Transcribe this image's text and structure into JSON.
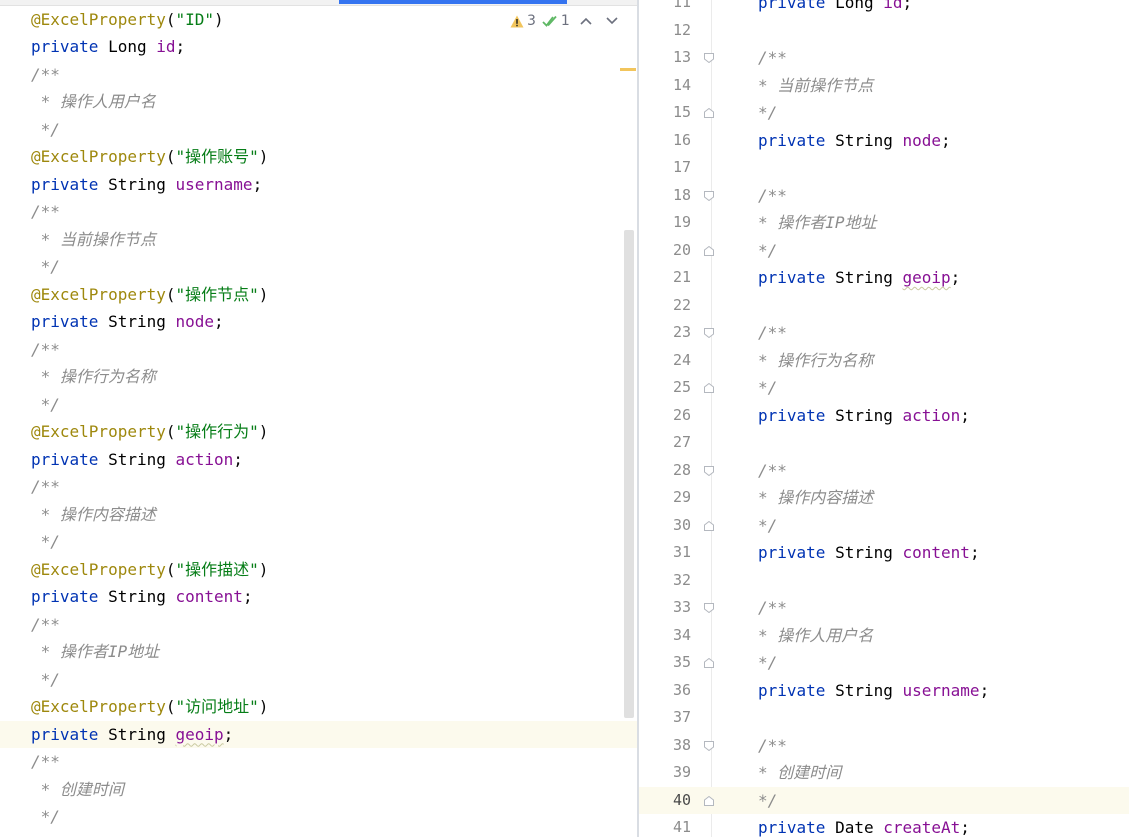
{
  "inspection": {
    "warnings": "3",
    "weak_warnings": "1"
  },
  "left_editor": {
    "lines": [
      {
        "tokens": [
          {
            "t": "anno",
            "v": "@ExcelProperty"
          },
          {
            "t": "plain",
            "v": "("
          },
          {
            "t": "str",
            "v": "\"ID\""
          },
          {
            "t": "plain",
            "v": ")"
          }
        ]
      },
      {
        "tokens": [
          {
            "t": "kw",
            "v": "private "
          },
          {
            "t": "typ",
            "v": "Long "
          },
          {
            "t": "fld",
            "v": "id"
          },
          {
            "t": "plain",
            "v": ";"
          }
        ]
      },
      {
        "tokens": [
          {
            "t": "cmt",
            "v": "/**"
          }
        ]
      },
      {
        "tokens": [
          {
            "t": "cmt",
            "v": " * 操作人用户名"
          }
        ]
      },
      {
        "tokens": [
          {
            "t": "cmt",
            "v": " */"
          }
        ]
      },
      {
        "tokens": [
          {
            "t": "anno",
            "v": "@ExcelProperty"
          },
          {
            "t": "plain",
            "v": "("
          },
          {
            "t": "str",
            "v": "\"操作账号\""
          },
          {
            "t": "plain",
            "v": ")"
          }
        ]
      },
      {
        "tokens": [
          {
            "t": "kw",
            "v": "private "
          },
          {
            "t": "typ",
            "v": "String "
          },
          {
            "t": "fld",
            "v": "username"
          },
          {
            "t": "plain",
            "v": ";"
          }
        ]
      },
      {
        "tokens": [
          {
            "t": "cmt",
            "v": "/**"
          }
        ]
      },
      {
        "tokens": [
          {
            "t": "cmt",
            "v": " * 当前操作节点"
          }
        ]
      },
      {
        "tokens": [
          {
            "t": "cmt",
            "v": " */"
          }
        ]
      },
      {
        "tokens": [
          {
            "t": "anno",
            "v": "@ExcelProperty"
          },
          {
            "t": "plain",
            "v": "("
          },
          {
            "t": "str",
            "v": "\"操作节点\""
          },
          {
            "t": "plain",
            "v": ")"
          }
        ]
      },
      {
        "tokens": [
          {
            "t": "kw",
            "v": "private "
          },
          {
            "t": "typ",
            "v": "String "
          },
          {
            "t": "fld",
            "v": "node"
          },
          {
            "t": "plain",
            "v": ";"
          }
        ]
      },
      {
        "tokens": [
          {
            "t": "cmt",
            "v": "/**"
          }
        ]
      },
      {
        "tokens": [
          {
            "t": "cmt",
            "v": " * 操作行为名称"
          }
        ]
      },
      {
        "tokens": [
          {
            "t": "cmt",
            "v": " */"
          }
        ]
      },
      {
        "tokens": [
          {
            "t": "anno",
            "v": "@ExcelProperty"
          },
          {
            "t": "plain",
            "v": "("
          },
          {
            "t": "str",
            "v": "\"操作行为\""
          },
          {
            "t": "plain",
            "v": ")"
          }
        ]
      },
      {
        "tokens": [
          {
            "t": "kw",
            "v": "private "
          },
          {
            "t": "typ",
            "v": "String "
          },
          {
            "t": "fld",
            "v": "action"
          },
          {
            "t": "plain",
            "v": ";"
          }
        ]
      },
      {
        "tokens": [
          {
            "t": "cmt",
            "v": "/**"
          }
        ]
      },
      {
        "tokens": [
          {
            "t": "cmt",
            "v": " * 操作内容描述"
          }
        ]
      },
      {
        "tokens": [
          {
            "t": "cmt",
            "v": " */"
          }
        ]
      },
      {
        "tokens": [
          {
            "t": "anno",
            "v": "@ExcelProperty"
          },
          {
            "t": "plain",
            "v": "("
          },
          {
            "t": "str",
            "v": "\"操作描述\""
          },
          {
            "t": "plain",
            "v": ")"
          }
        ]
      },
      {
        "tokens": [
          {
            "t": "kw",
            "v": "private "
          },
          {
            "t": "typ",
            "v": "String "
          },
          {
            "t": "fld",
            "v": "content"
          },
          {
            "t": "plain",
            "v": ";"
          }
        ]
      },
      {
        "tokens": [
          {
            "t": "cmt",
            "v": "/**"
          }
        ]
      },
      {
        "tokens": [
          {
            "t": "cmt",
            "v": " * 操作者IP地址"
          }
        ]
      },
      {
        "tokens": [
          {
            "t": "cmt",
            "v": " */"
          }
        ]
      },
      {
        "tokens": [
          {
            "t": "anno",
            "v": "@ExcelProperty"
          },
          {
            "t": "plain",
            "v": "("
          },
          {
            "t": "str",
            "v": "\"访问地址\""
          },
          {
            "t": "plain",
            "v": ")"
          }
        ]
      },
      {
        "current": true,
        "tokens": [
          {
            "t": "kw",
            "v": "private "
          },
          {
            "t": "typ",
            "v": "String "
          },
          {
            "t": "fld squiggle",
            "v": "geoip"
          },
          {
            "t": "plain",
            "v": ";"
          }
        ]
      },
      {
        "tokens": [
          {
            "t": "cmt",
            "v": "/**"
          }
        ]
      },
      {
        "tokens": [
          {
            "t": "cmt",
            "v": " * 创建时间"
          }
        ]
      },
      {
        "tokens": [
          {
            "t": "cmt",
            "v": " */"
          }
        ]
      }
    ]
  },
  "right_editor": {
    "lines": [
      {
        "num": "11",
        "tokens": [
          {
            "t": "kw",
            "v": "private "
          },
          {
            "t": "typ",
            "v": "Long "
          },
          {
            "t": "fld",
            "v": "id"
          },
          {
            "t": "plain",
            "v": ";"
          }
        ]
      },
      {
        "num": "12",
        "tokens": []
      },
      {
        "num": "13",
        "fold": "open",
        "tokens": [
          {
            "t": "cmt",
            "v": "/**"
          }
        ]
      },
      {
        "num": "14",
        "tokens": [
          {
            "t": "cmt",
            "v": "* 当前操作节点"
          }
        ]
      },
      {
        "num": "15",
        "fold": "close",
        "tokens": [
          {
            "t": "cmt",
            "v": "*/"
          }
        ]
      },
      {
        "num": "16",
        "tokens": [
          {
            "t": "kw",
            "v": "private "
          },
          {
            "t": "typ",
            "v": "String "
          },
          {
            "t": "fld",
            "v": "node"
          },
          {
            "t": "plain",
            "v": ";"
          }
        ]
      },
      {
        "num": "17",
        "tokens": []
      },
      {
        "num": "18",
        "fold": "open",
        "tokens": [
          {
            "t": "cmt",
            "v": "/**"
          }
        ]
      },
      {
        "num": "19",
        "tokens": [
          {
            "t": "cmt",
            "v": "* 操作者IP地址"
          }
        ]
      },
      {
        "num": "20",
        "fold": "close",
        "tokens": [
          {
            "t": "cmt",
            "v": "*/"
          }
        ]
      },
      {
        "num": "21",
        "tokens": [
          {
            "t": "kw",
            "v": "private "
          },
          {
            "t": "typ",
            "v": "String "
          },
          {
            "t": "fld squiggle",
            "v": "geoip"
          },
          {
            "t": "plain",
            "v": ";"
          }
        ]
      },
      {
        "num": "22",
        "tokens": []
      },
      {
        "num": "23",
        "fold": "open",
        "tokens": [
          {
            "t": "cmt",
            "v": "/**"
          }
        ]
      },
      {
        "num": "24",
        "tokens": [
          {
            "t": "cmt",
            "v": "* 操作行为名称"
          }
        ]
      },
      {
        "num": "25",
        "fold": "close",
        "tokens": [
          {
            "t": "cmt",
            "v": "*/"
          }
        ]
      },
      {
        "num": "26",
        "tokens": [
          {
            "t": "kw",
            "v": "private "
          },
          {
            "t": "typ",
            "v": "String "
          },
          {
            "t": "fld",
            "v": "action"
          },
          {
            "t": "plain",
            "v": ";"
          }
        ]
      },
      {
        "num": "27",
        "tokens": []
      },
      {
        "num": "28",
        "fold": "open",
        "tokens": [
          {
            "t": "cmt",
            "v": "/**"
          }
        ]
      },
      {
        "num": "29",
        "tokens": [
          {
            "t": "cmt",
            "v": "* 操作内容描述"
          }
        ]
      },
      {
        "num": "30",
        "fold": "close",
        "tokens": [
          {
            "t": "cmt",
            "v": "*/"
          }
        ]
      },
      {
        "num": "31",
        "tokens": [
          {
            "t": "kw",
            "v": "private "
          },
          {
            "t": "typ",
            "v": "String "
          },
          {
            "t": "fld",
            "v": "content"
          },
          {
            "t": "plain",
            "v": ";"
          }
        ]
      },
      {
        "num": "32",
        "tokens": []
      },
      {
        "num": "33",
        "fold": "open",
        "tokens": [
          {
            "t": "cmt",
            "v": "/**"
          }
        ]
      },
      {
        "num": "34",
        "tokens": [
          {
            "t": "cmt",
            "v": "* 操作人用户名"
          }
        ]
      },
      {
        "num": "35",
        "fold": "close",
        "tokens": [
          {
            "t": "cmt",
            "v": "*/"
          }
        ]
      },
      {
        "num": "36",
        "tokens": [
          {
            "t": "kw",
            "v": "private "
          },
          {
            "t": "typ",
            "v": "String "
          },
          {
            "t": "fld",
            "v": "username"
          },
          {
            "t": "plain",
            "v": ";"
          }
        ]
      },
      {
        "num": "37",
        "tokens": []
      },
      {
        "num": "38",
        "fold": "open",
        "tokens": [
          {
            "t": "cmt",
            "v": "/**"
          }
        ]
      },
      {
        "num": "39",
        "tokens": [
          {
            "t": "cmt",
            "v": "* 创建时间"
          }
        ]
      },
      {
        "num": "40",
        "fold": "close",
        "current": true,
        "tokens": [
          {
            "t": "cmt",
            "v": "*/"
          }
        ]
      },
      {
        "num": "41",
        "tokens": [
          {
            "t": "kw",
            "v": "private "
          },
          {
            "t": "typ",
            "v": "Date "
          },
          {
            "t": "fld",
            "v": "createAt"
          },
          {
            "t": "plain",
            "v": ";"
          }
        ]
      }
    ]
  },
  "colors": {
    "accent": "#3574f0",
    "warning": "#f2c55c",
    "current_line": "#fcfaed"
  }
}
